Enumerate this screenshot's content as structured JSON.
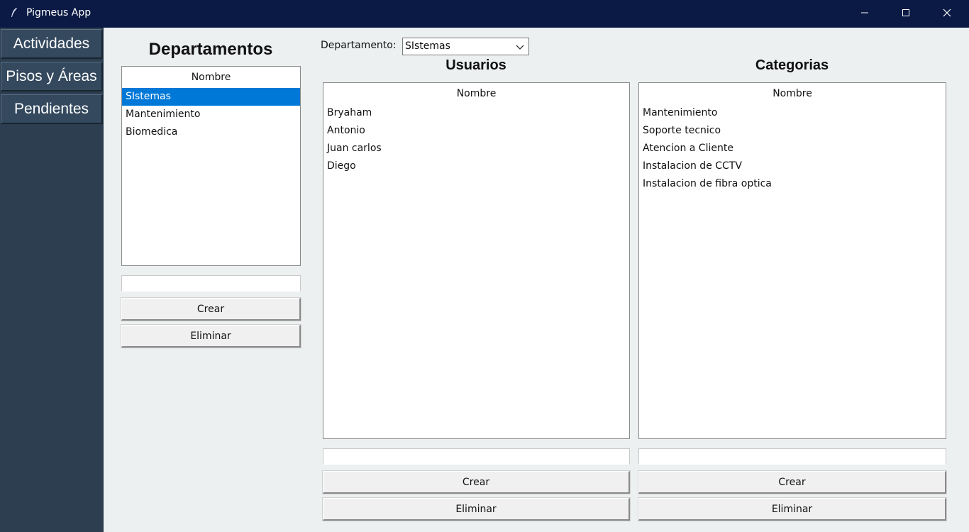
{
  "window": {
    "title": "Pigmeus App"
  },
  "sidebar": {
    "items": [
      {
        "label": "Actividades"
      },
      {
        "label": "Pisos y Áreas"
      },
      {
        "label": "Pendientes"
      }
    ]
  },
  "departamentos": {
    "title": "Departamentos",
    "column_header": "Nombre",
    "items": [
      "SIstemas",
      "Mantenimiento",
      "Biomedica"
    ],
    "selected_index": 0,
    "entry_value": "",
    "create_label": "Crear",
    "delete_label": "Eliminar"
  },
  "filter": {
    "label": "Departamento:",
    "selected": "SIstemas"
  },
  "usuarios": {
    "title": "Usuarios",
    "column_header": "Nombre",
    "items": [
      "Bryaham",
      "Antonio",
      "Juan carlos",
      "Diego"
    ],
    "entry_value": "",
    "create_label": "Crear",
    "delete_label": "Eliminar"
  },
  "categorias": {
    "title": "Categorias",
    "column_header": "Nombre",
    "items": [
      "Mantenimiento",
      "Soporte tecnico",
      "Atencion a Cliente",
      "Instalacion de CCTV",
      "Instalacion de fibra optica"
    ],
    "entry_value": "",
    "create_label": "Crear",
    "delete_label": "Eliminar"
  },
  "colors": {
    "titlebar": "#0b1a44",
    "sidebar": "#2c3e50",
    "nav_button": "#34495e",
    "content_bg": "#ecf0f1",
    "selection": "#0078d7"
  },
  "icons": {
    "app": "feather-icon",
    "minimize": "minimize-icon",
    "maximize": "maximize-icon",
    "close": "close-icon",
    "dropdown": "chevron-down-icon"
  }
}
